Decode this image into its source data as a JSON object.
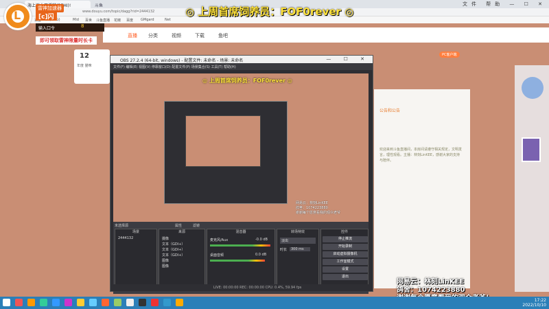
{
  "browser": {
    "tab1": "海上迷人开播啦(BEHI)!",
    "tab2": "斗鱼",
    "url": "www.douyu.com/topic/dagg?rid=2444132",
    "controls": "文件 帮助 — ☐ ✕",
    "bookmarks": [
      "百度",
      "(BMG)",
      "Mid",
      "百世",
      "斗鱼直播",
      "花椒",
      "百度",
      "GMgard",
      "Net"
    ]
  },
  "brand": {
    "tag1": "雷神加速器",
    "tag2": "[c]闪"
  },
  "promo": {
    "box": "输入口令",
    "num": "8",
    "text": "即可领取雷神限量时长卡"
  },
  "top_title": "◎ 上周首席饲养员：FOF0rever ◎",
  "site": {
    "nav": [
      "直播",
      "分类",
      "视频",
      "下载",
      "鱼吧"
    ],
    "left_num": "12",
    "left_sub": "年度 猫咪",
    "pc_client": "PC客户端",
    "chat_header": "公告和公告",
    "chat_text": "欢迎来到斗鱼直播间，本房间请遵守相关规定，文明发言，理性观看。主播：林刻LinKEE，感谢大家的支持与陪伴。"
  },
  "obs": {
    "title": "OBS 27.2.4 (64-bit, windows) - 配置文件: 未命名 - 场景: 未命名",
    "window_controls": "— ☐ ✕",
    "menu": "文件(F)  编辑(E)  视图(V)  停靠窗口(D)  配置文件(P)  场景集合(S)  工具(T)  帮助(H)",
    "nested_title": "◎ 上周首席饲养员：FOF0rever ◎",
    "nested_overlay": [
      "网易云：林刻LinKEE",
      "鸽舍：1074223880",
      "谢谢每个愿意看我的观众老爷"
    ],
    "scene_label": "未选择源",
    "tab_props": "属性",
    "tab_filters": "滤镜",
    "docks": [
      "场景",
      "来源",
      "混音器",
      "转场特效",
      "控件"
    ],
    "scene_item": "2444132",
    "sources": [
      "摄像",
      "文本（GDI+）",
      "文本（GDI+）",
      "文本（GDI+）",
      "图像",
      "图像"
    ],
    "mixer": [
      {
        "name": "麦克风/Aux",
        "db": "-0.0 dB"
      },
      {
        "name": "桌面音频",
        "db": "0.0 dB"
      }
    ],
    "transition": {
      "type": "淡出",
      "duration_label": "时长",
      "duration": "300 ms"
    },
    "controls": [
      "停止推流",
      "开始录制",
      "启动虚拟摄像机",
      "工作室模式",
      "设置",
      "退出"
    ],
    "status": "LIVE: 00:00:00   REC: 00:00:00   CPU: 0.4%, 59.94 fps"
  },
  "overlay": [
    "网易云：林刻LinKEE",
    "鸽舍：1074223880",
    "谢谢每个愿意看我的观众老爷！"
  ],
  "taskbar": {
    "time": "17:22",
    "date": "2022/10/10"
  },
  "colors": {
    "page": "#c98e74",
    "accent": "#f08b1c",
    "title_yellow": "#ffe23b",
    "taskbar": "#2b7fb8"
  }
}
